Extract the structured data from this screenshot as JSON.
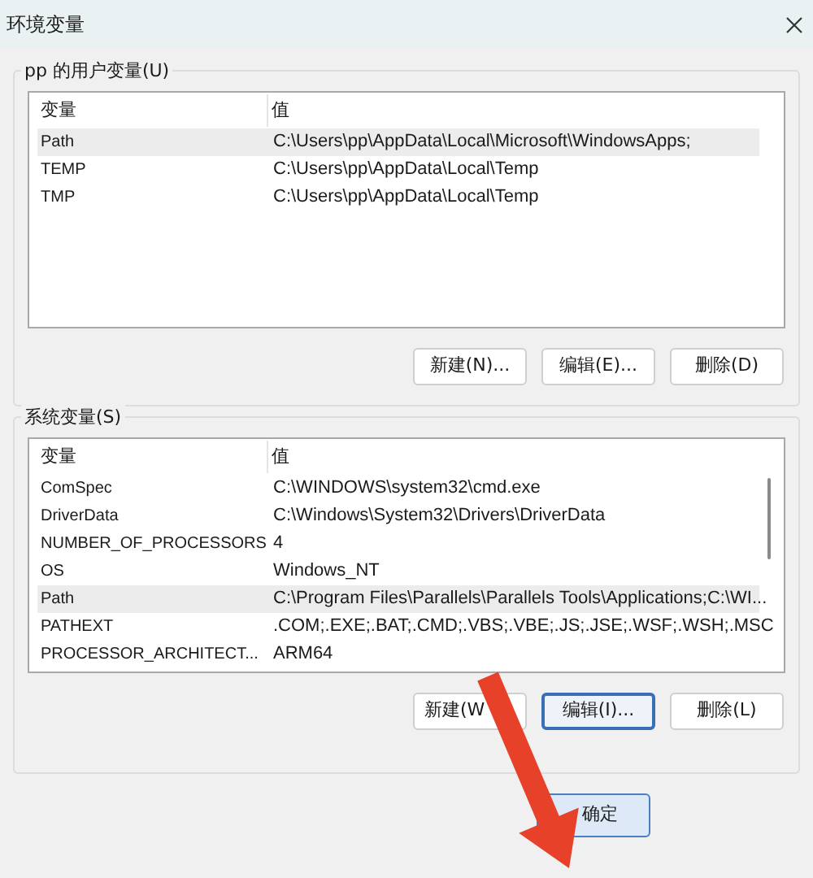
{
  "window": {
    "title": "环境变量"
  },
  "user_variables": {
    "label": "pp 的用户变量(U)",
    "columns": [
      "变量",
      "值"
    ],
    "rows": [
      {
        "name": "Path",
        "value": "C:\\Users\\pp\\AppData\\Local\\Microsoft\\WindowsApps;",
        "selected": true
      },
      {
        "name": "TEMP",
        "value": "C:\\Users\\pp\\AppData\\Local\\Temp",
        "selected": false
      },
      {
        "name": "TMP",
        "value": "C:\\Users\\pp\\AppData\\Local\\Temp",
        "selected": false
      }
    ],
    "buttons": [
      {
        "label": "新建(N)...",
        "focused": false
      },
      {
        "label": "编辑(E)...",
        "focused": false
      },
      {
        "label": "删除(D)",
        "focused": false
      }
    ]
  },
  "system_variables": {
    "label": "系统变量(S)",
    "columns": [
      "变量",
      "值"
    ],
    "rows": [
      {
        "name": "ComSpec",
        "value": "C:\\WINDOWS\\system32\\cmd.exe",
        "selected": false
      },
      {
        "name": "DriverData",
        "value": "C:\\Windows\\System32\\Drivers\\DriverData",
        "selected": false
      },
      {
        "name": "NUMBER_OF_PROCESSORS",
        "value": "4",
        "selected": false
      },
      {
        "name": "OS",
        "value": "Windows_NT",
        "selected": false
      },
      {
        "name": "Path",
        "value": "C:\\Program Files\\Parallels\\Parallels Tools\\Applications;C:\\WI...",
        "selected": true
      },
      {
        "name": "PATHEXT",
        "value": ".COM;.EXE;.BAT;.CMD;.VBS;.VBE;.JS;.JSE;.WSF;.WSH;.MSC",
        "selected": false
      },
      {
        "name": "PROCESSOR_ARCHITECT...",
        "value": "ARM64",
        "selected": false
      }
    ],
    "buttons": [
      {
        "label": "新建(W",
        "focused": false
      },
      {
        "label": "编辑(I)...",
        "focused": true
      },
      {
        "label": "删除(L)",
        "focused": false
      }
    ]
  },
  "dialog_buttons": [
    {
      "label": "确定",
      "default": true
    }
  ]
}
